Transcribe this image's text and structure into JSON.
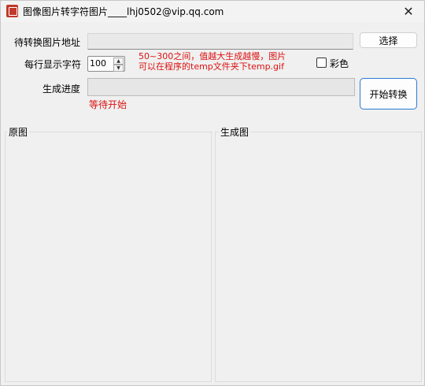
{
  "window": {
    "title": "图像图片转字符图片____lhj0502@vip.qq.com",
    "close_glyph": "✕"
  },
  "form": {
    "path_label": "待转换图片地址",
    "path_value": "",
    "browse_button": "选择",
    "chars_label": "每行显示字符",
    "chars_value": "100",
    "hint_line1": "50~300之间，值越大生成越慢，图片",
    "hint_line2": "可以在程序的temp文件夹下temp.gif",
    "color_label": "彩色",
    "color_checked": false,
    "progress_label": "生成进度",
    "progress_value": 0,
    "status_text": "等待开始",
    "start_button": "开始转换"
  },
  "panels": {
    "original_title": "原图",
    "generated_title": "生成图"
  },
  "colors": {
    "hint": "#dd1111",
    "accent_border": "#2a7ad3"
  },
  "icons": {
    "app": "app-icon",
    "close": "close-icon",
    "spin_up": "arrow-up-icon",
    "spin_down": "arrow-down-icon"
  }
}
